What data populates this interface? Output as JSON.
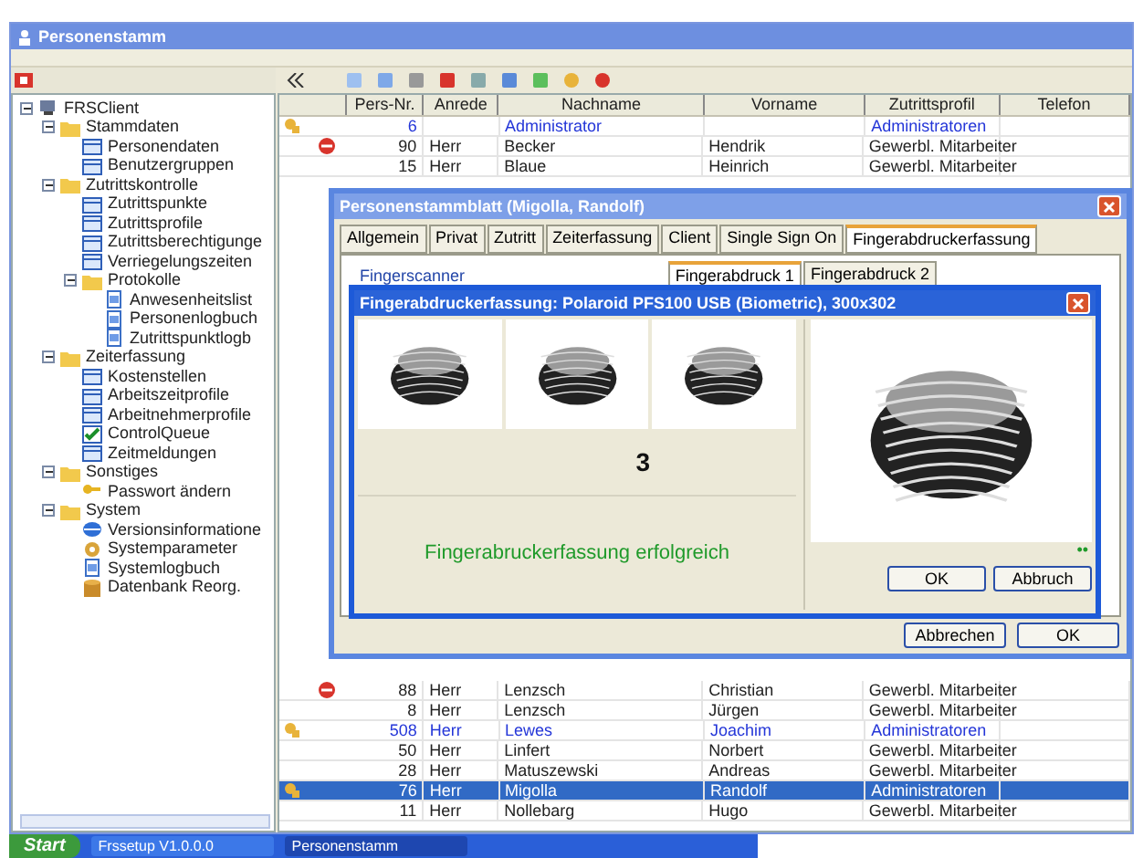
{
  "window": {
    "title": "Personenstamm"
  },
  "tree": [
    {
      "label": "FRSClient",
      "kind": "root",
      "expanded": true,
      "children": [
        {
          "label": "Stammdaten",
          "kind": "folder",
          "expanded": true,
          "children": [
            {
              "label": "Personendaten",
              "kind": "table"
            },
            {
              "label": "Benutzergruppen",
              "kind": "table"
            }
          ]
        },
        {
          "label": "Zutrittskontrolle",
          "kind": "folder",
          "expanded": true,
          "children": [
            {
              "label": "Zutrittspunkte",
              "kind": "table"
            },
            {
              "label": "Zutrittsprofile",
              "kind": "table"
            },
            {
              "label": "Zutrittsberechtigunge",
              "kind": "table"
            },
            {
              "label": "Verriegelungszeiten",
              "kind": "table"
            },
            {
              "label": "Protokolle",
              "kind": "folder",
              "expanded": true,
              "children": [
                {
                  "label": "Anwesenheitslist",
                  "kind": "log"
                },
                {
                  "label": "Personenlogbuch",
                  "kind": "log"
                },
                {
                  "label": "Zutrittspunktlogb",
                  "kind": "log"
                }
              ]
            }
          ]
        },
        {
          "label": "Zeiterfassung",
          "kind": "folder",
          "expanded": true,
          "children": [
            {
              "label": "Kostenstellen",
              "kind": "table"
            },
            {
              "label": "Arbeitszeitprofile",
              "kind": "table"
            },
            {
              "label": "Arbeitnehmerprofile",
              "kind": "table"
            },
            {
              "label": "ControlQueue",
              "kind": "check"
            },
            {
              "label": "Zeitmeldungen",
              "kind": "table"
            }
          ]
        },
        {
          "label": "Sonstiges",
          "kind": "folder",
          "expanded": true,
          "children": [
            {
              "label": "Passwort ändern",
              "kind": "key"
            }
          ]
        },
        {
          "label": "System",
          "kind": "folder",
          "expanded": true,
          "children": [
            {
              "label": "Versionsinformatione",
              "kind": "info"
            },
            {
              "label": "Systemparameter",
              "kind": "setting"
            },
            {
              "label": "Systemlogbuch",
              "kind": "log"
            },
            {
              "label": "Datenbank Reorg.",
              "kind": "db"
            }
          ]
        }
      ]
    }
  ],
  "table": {
    "columns": [
      "Pers-Nr.",
      "Anrede",
      "Nachname",
      "Vorname",
      "Zutrittsprofil",
      "Telefon"
    ],
    "rows_top": [
      {
        "kind": "admin",
        "selected": false,
        "cells": [
          "6",
          "",
          "Administrator",
          "",
          "Administratoren",
          ""
        ]
      },
      {
        "kind": "blocked",
        "selected": false,
        "cells": [
          "90",
          "Herr",
          "Becker",
          "Hendrik",
          "Gewerbl. Mitarbeiter",
          ""
        ]
      },
      {
        "kind": "plain",
        "selected": false,
        "cells": [
          "15",
          "Herr",
          "Blaue",
          "Heinrich",
          "Gewerbl. Mitarbeiter",
          ""
        ]
      }
    ],
    "rows_bottom": [
      {
        "kind": "blocked",
        "selected": false,
        "cells": [
          "88",
          "Herr",
          "Lenzsch",
          "Christian",
          "Gewerbl. Mitarbeiter",
          ""
        ]
      },
      {
        "kind": "plain",
        "selected": false,
        "cells": [
          "8",
          "Herr",
          "Lenzsch",
          "Jürgen",
          "Gewerbl. Mitarbeiter",
          ""
        ]
      },
      {
        "kind": "admin",
        "selected": false,
        "cells": [
          "508",
          "Herr",
          "Lewes",
          "Joachim",
          "Administratoren",
          ""
        ]
      },
      {
        "kind": "plain",
        "selected": false,
        "cells": [
          "50",
          "Herr",
          "Linfert",
          "Norbert",
          "Gewerbl. Mitarbeiter",
          ""
        ]
      },
      {
        "kind": "plain",
        "selected": false,
        "cells": [
          "28",
          "Herr",
          "Matuszewski",
          "Andreas",
          "Gewerbl. Mitarbeiter",
          ""
        ]
      },
      {
        "kind": "admin",
        "selected": true,
        "cells": [
          "76",
          "Herr",
          "Migolla",
          "Randolf",
          "Administratoren",
          ""
        ]
      },
      {
        "kind": "plain",
        "selected": false,
        "cells": [
          "11",
          "Herr",
          "Nollebarg",
          "Hugo",
          "Gewerbl. Mitarbeiter",
          ""
        ]
      }
    ]
  },
  "dialog": {
    "title": "Personenstammblatt (Migolla, Randolf)",
    "tabs": [
      {
        "label": "Allgemein",
        "selected": false
      },
      {
        "label": "Privat",
        "selected": false
      },
      {
        "label": "Zutritt",
        "selected": false
      },
      {
        "label": "Zeiterfassung",
        "selected": false
      },
      {
        "label": "Client",
        "selected": false
      },
      {
        "label": "Single Sign On",
        "selected": false
      },
      {
        "label": "Fingerabdruckerfassung",
        "selected": true
      }
    ],
    "section_label": "Fingerscanner",
    "subtabs": [
      {
        "label": "Fingerabdruck 1",
        "selected": true
      },
      {
        "label": "Fingerabdruck 2",
        "selected": false
      }
    ],
    "buttons": [
      "Abbrechen",
      "OK"
    ]
  },
  "capture": {
    "title": "Fingerabdruckerfassung: Polaroid PFS100 USB (Biometric), 300x302",
    "count": "3",
    "message": "Fingerabruckerfassung erfolgreich",
    "indicator": "••",
    "buttons": [
      "OK",
      "Abbruch"
    ]
  },
  "taskbar": {
    "start": "Start",
    "tasks": [
      {
        "label": "Frssetup V1.0.0.0",
        "selected": false
      },
      {
        "label": "Personenstamm",
        "selected": true
      }
    ]
  }
}
